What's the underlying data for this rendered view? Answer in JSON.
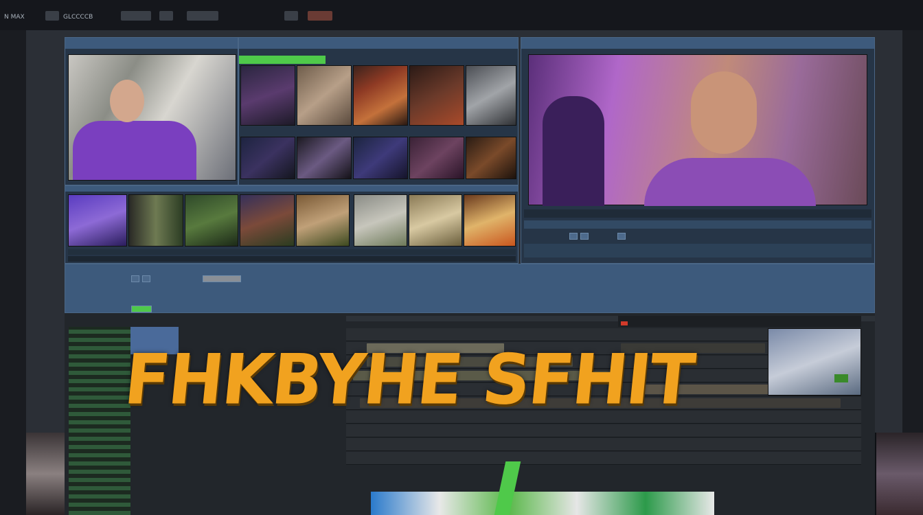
{
  "window": {
    "menu": [
      "N MAX",
      "GLCCCCB"
    ],
    "colors": {
      "accent": "#f1a21f",
      "panel": "#263547",
      "header": "#3d5a7c",
      "selection_green": "#4fc94a"
    }
  },
  "overlay_title": "FHKBYHE SFHIT",
  "source_monitor": {
    "label": ""
  },
  "bins": {
    "header_label": ""
  },
  "program_monitor": {
    "label": ""
  },
  "timeline": {
    "label": ""
  },
  "icons": [
    "play-icon",
    "stop-icon",
    "scissors-icon",
    "folder-icon",
    "gear-icon"
  ]
}
